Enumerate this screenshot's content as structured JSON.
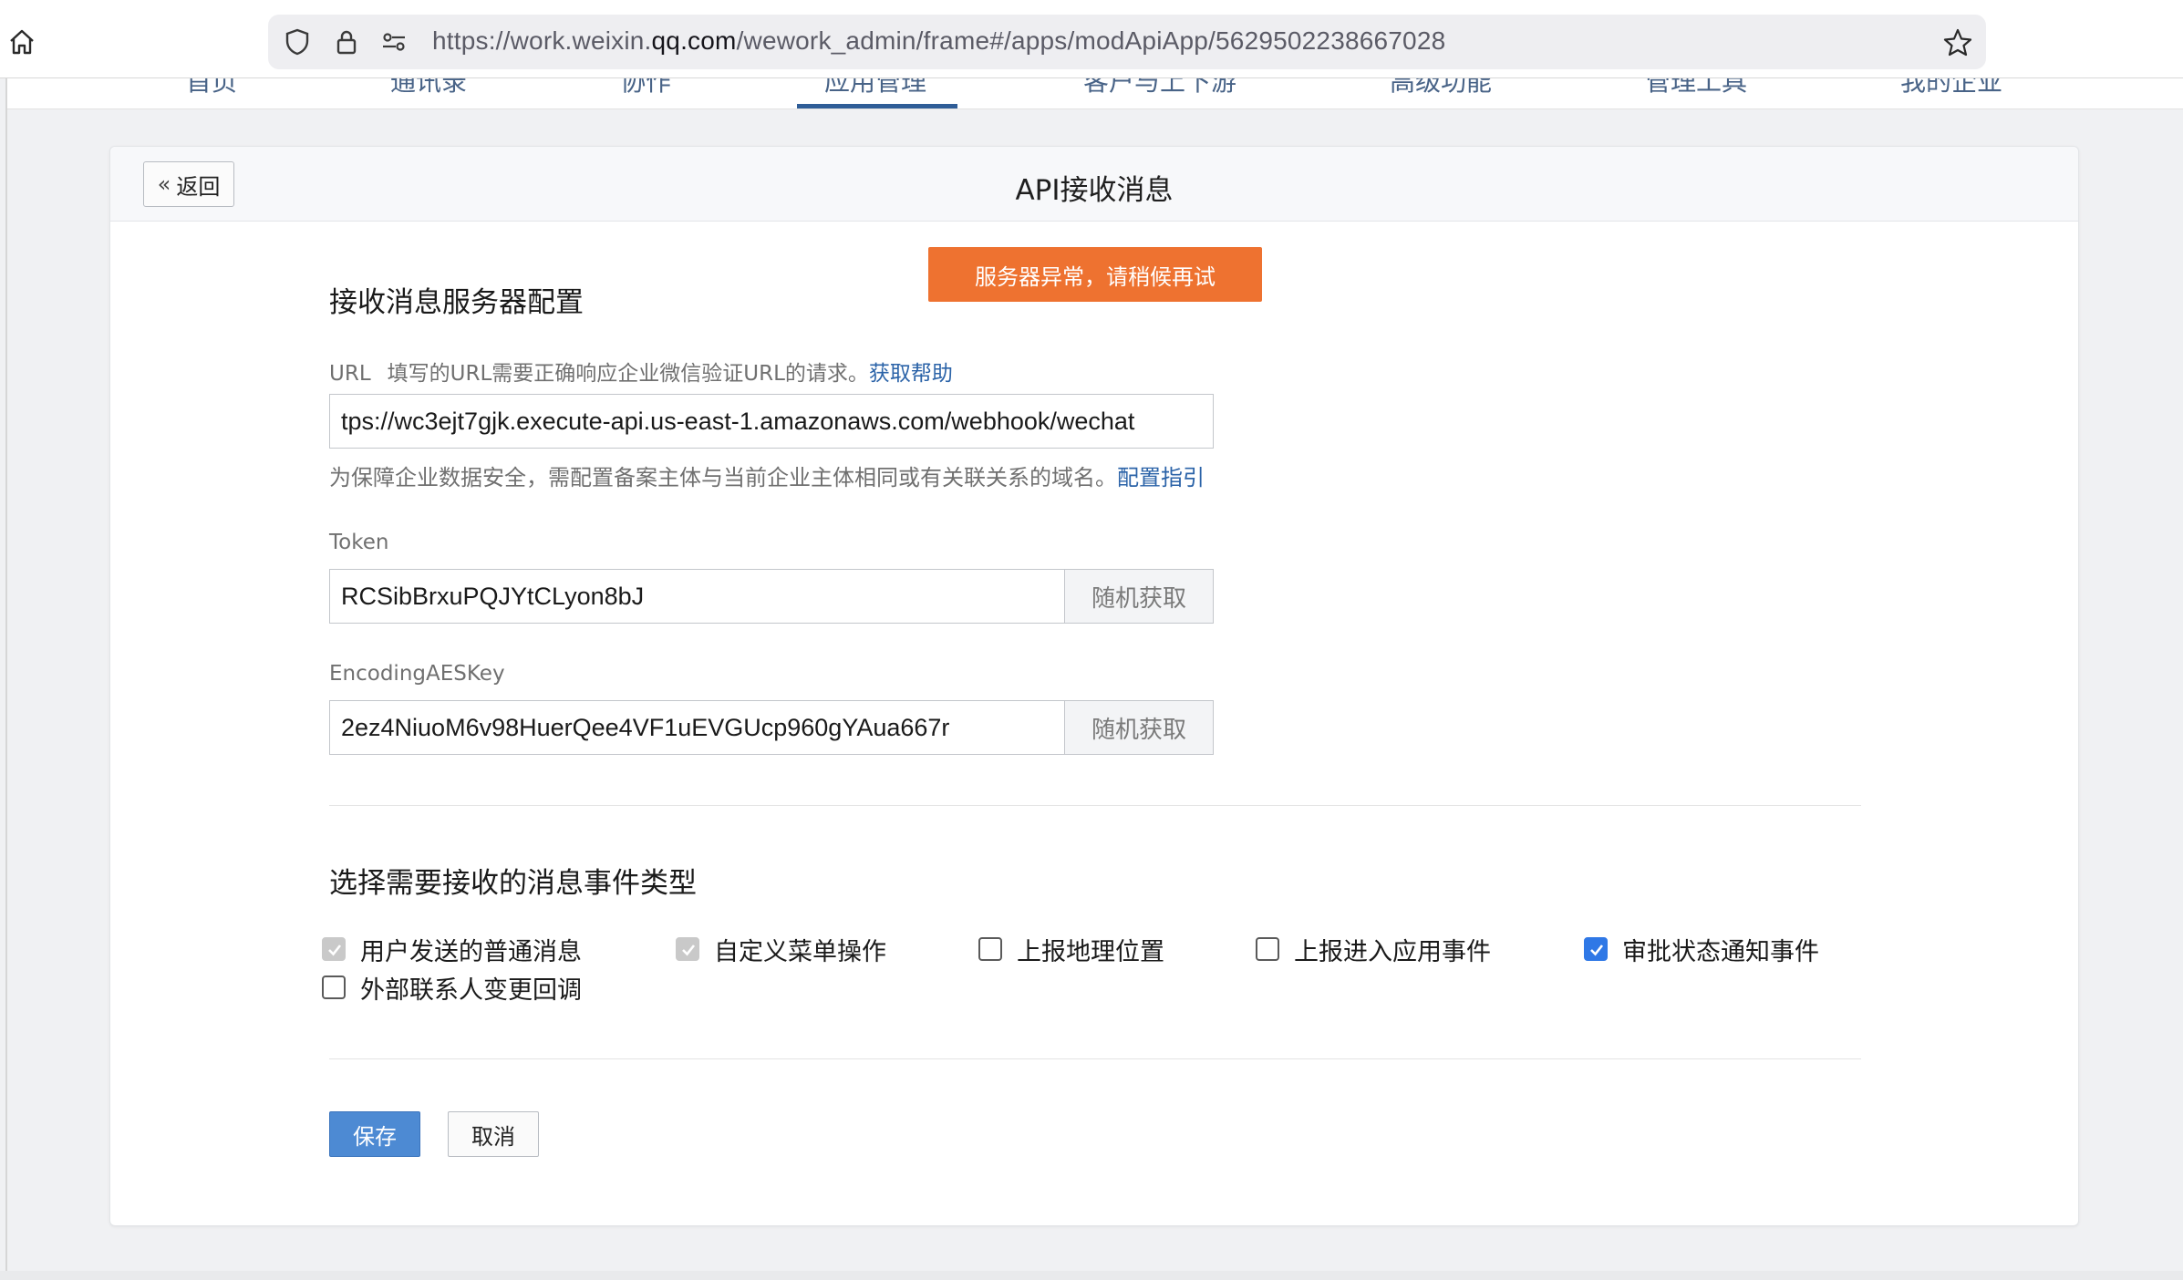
{
  "browser": {
    "url_prefix": "https://work.weixin.",
    "url_host": "qq.com",
    "url_path": "/wework_admin/frame#/apps/modApiApp/5629502238667028"
  },
  "appnav": {
    "items": [
      "首页",
      "通讯录",
      "协作",
      "应用管理",
      "客户与上下游",
      "高级功能",
      "管理工具",
      "我的企业"
    ]
  },
  "header": {
    "back_label": "返回",
    "title": "API接收消息"
  },
  "toast": {
    "text": "服务器异常，请稍候再试"
  },
  "server_config": {
    "title": "接收消息服务器配置",
    "url_label": "URL",
    "url_desc": "填写的URL需要正确响应企业微信验证URL的请求。",
    "url_help_link": "获取帮助",
    "url_value": "tps://wc3ejt7gjk.execute-api.us-east-1.amazonaws.com/webhook/wechat",
    "url_hint": "为保障企业数据安全，需配置备案主体与当前企业主体相同或有关联关系的域名。",
    "url_hint_link": "配置指引",
    "token_label": "Token",
    "token_value": "RCSibBrxuPQJYtCLyon8bJ",
    "aes_label": "EncodingAESKey",
    "aes_value": "2ez4NiuoM6v98HuerQee4VF1uEVGUcp960gYAua667r",
    "random_label": "随机获取"
  },
  "events": {
    "title": "选择需要接收的消息事件类型",
    "options": [
      {
        "label": "用户发送的普通消息",
        "state": "checked-disabled"
      },
      {
        "label": "自定义菜单操作",
        "state": "checked-disabled"
      },
      {
        "label": "上报地理位置",
        "state": "unchecked"
      },
      {
        "label": "上报进入应用事件",
        "state": "unchecked"
      },
      {
        "label": "审批状态通知事件",
        "state": "checked"
      },
      {
        "label": "外部联系人变更回调",
        "state": "unchecked"
      }
    ]
  },
  "actions": {
    "save_label": "保存",
    "cancel_label": "取消"
  },
  "colors": {
    "toast_bg": "#ee7230",
    "link": "#2b63a8",
    "primary_button": "#4d8ad3",
    "checkbox_checked": "#2f78e6"
  }
}
